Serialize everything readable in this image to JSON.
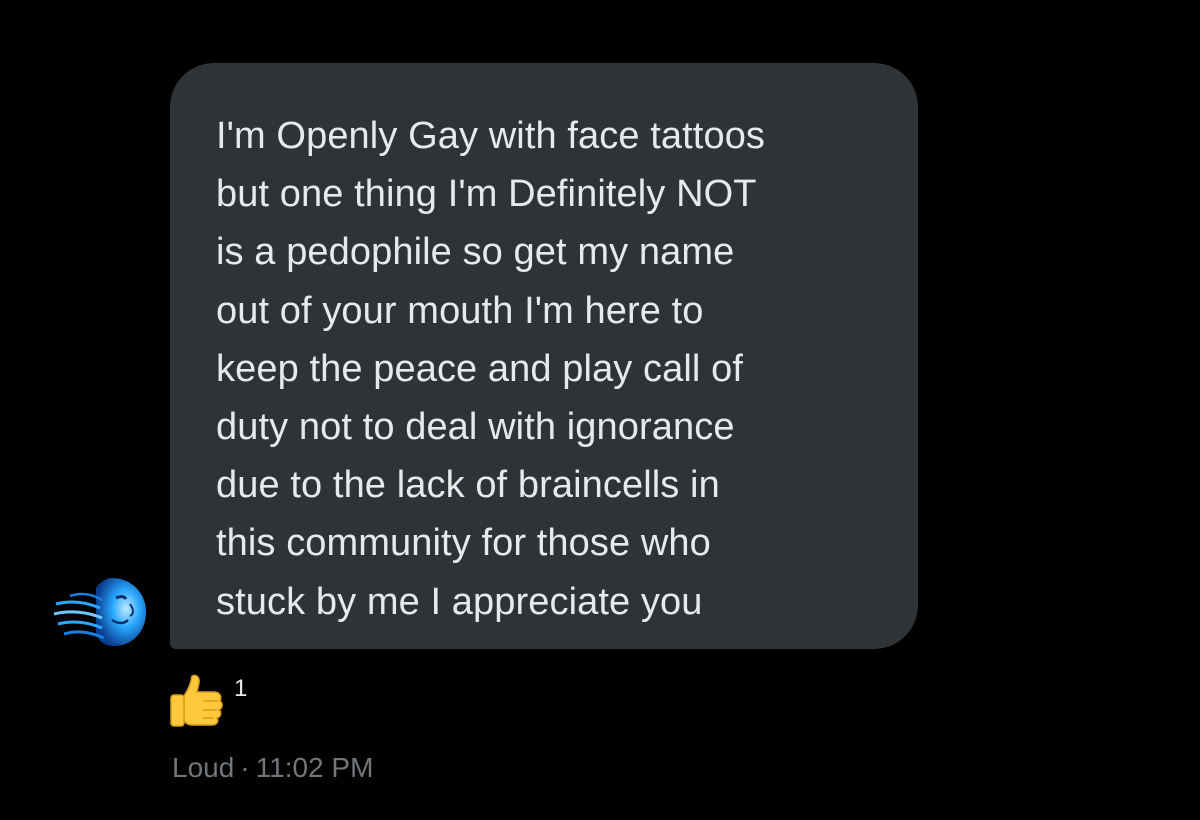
{
  "message": {
    "lines": [
      "I'm Openly Gay with face tattoos",
      "but one thing I'm Definitely NOT",
      "is a pedophile so get my name",
      "out of your mouth I'm here to",
      "keep the peace and play call of",
      "duty not to deal with ignorance",
      "due to the lack of braincells in",
      "this community for those who",
      "stuck by me I appreciate you"
    ]
  },
  "reaction": {
    "emoji": "thumbs-up-icon",
    "count": "1"
  },
  "meta": {
    "sender": "Loud",
    "separator": "·",
    "time": "11:02 PM"
  },
  "colors": {
    "background": "#000000",
    "bubble": "#2f3336",
    "text": "#e7e9ea",
    "muted": "#71767b",
    "avatar_accent": "#2aa8ff",
    "emoji_yellow": "#ffc83d"
  }
}
